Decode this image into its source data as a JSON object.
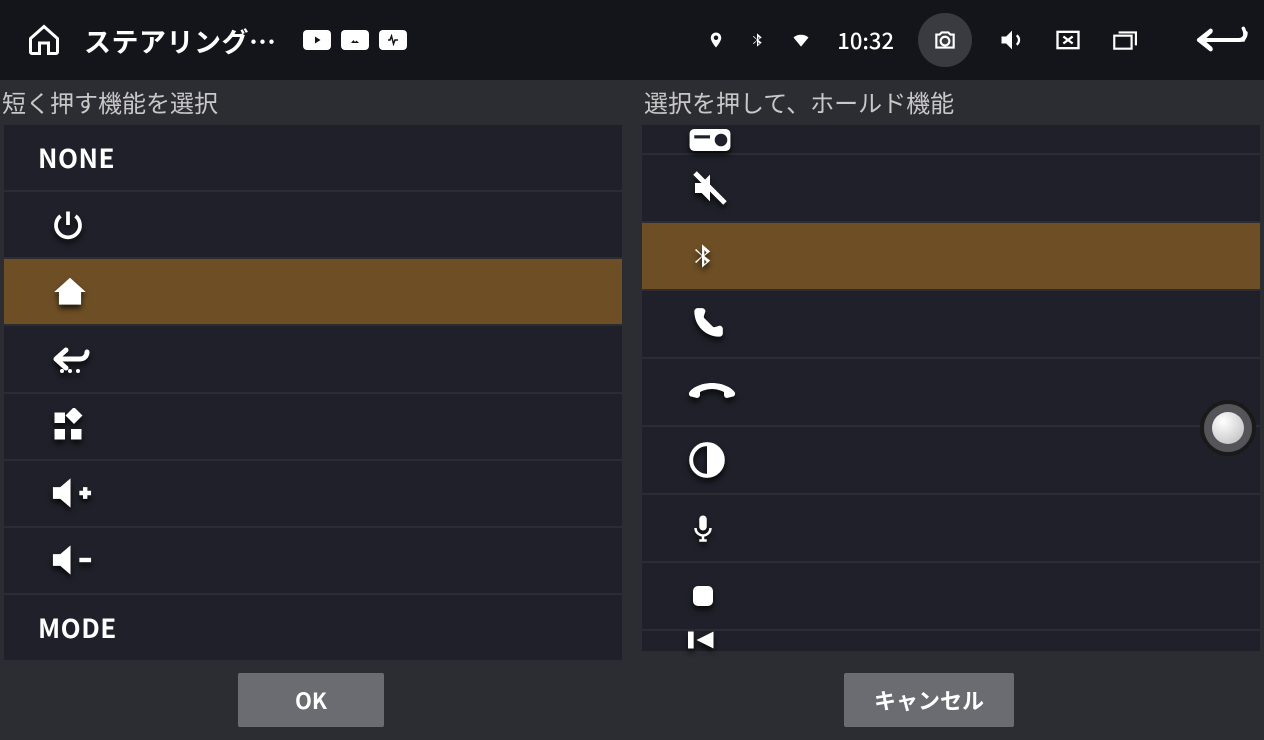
{
  "statusbar": {
    "title": "ステアリング…",
    "clock": "10:32"
  },
  "left_panel": {
    "header": "短く押す機能を選択",
    "items": [
      {
        "kind": "text",
        "label": "NONE",
        "selected": false,
        "icon": null
      },
      {
        "kind": "icon",
        "label": "",
        "selected": false,
        "icon": "power"
      },
      {
        "kind": "icon",
        "label": "",
        "selected": true,
        "icon": "home"
      },
      {
        "kind": "icon",
        "label": "",
        "selected": false,
        "icon": "back-dots"
      },
      {
        "kind": "icon",
        "label": "",
        "selected": false,
        "icon": "widgets"
      },
      {
        "kind": "icon",
        "label": "",
        "selected": false,
        "icon": "vol-up"
      },
      {
        "kind": "icon",
        "label": "",
        "selected": false,
        "icon": "vol-down"
      },
      {
        "kind": "text",
        "label": "MODE",
        "selected": false,
        "icon": null
      }
    ]
  },
  "right_panel": {
    "header": "選択を押して、ホールド機能",
    "items": [
      {
        "icon": "radio",
        "selected": false
      },
      {
        "icon": "mute",
        "selected": false
      },
      {
        "icon": "bluetooth",
        "selected": true
      },
      {
        "icon": "phone",
        "selected": false
      },
      {
        "icon": "hangup",
        "selected": false
      },
      {
        "icon": "contrast",
        "selected": false
      },
      {
        "icon": "mic",
        "selected": false
      },
      {
        "icon": "stop",
        "selected": false
      }
    ]
  },
  "footer": {
    "ok": "OK",
    "cancel": "キャンセル"
  }
}
